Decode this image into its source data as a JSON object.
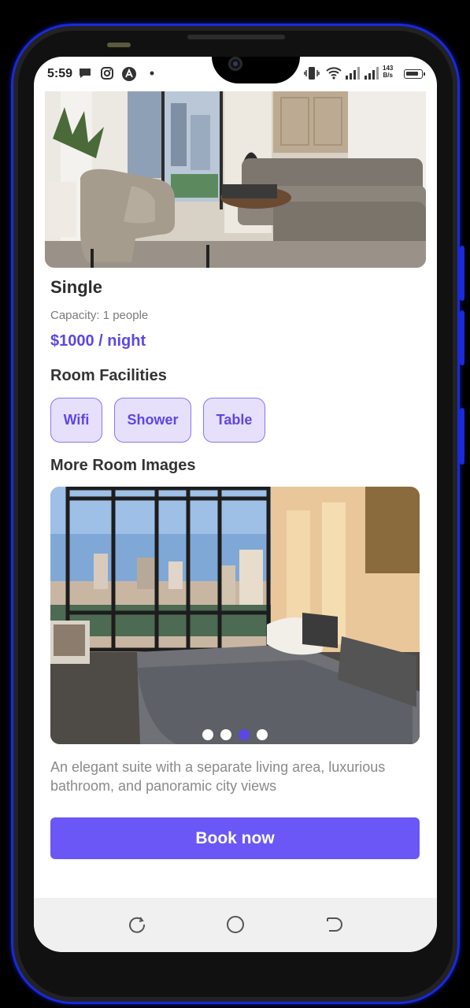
{
  "status_bar": {
    "time": "5:59",
    "net_speed_value": "143",
    "net_speed_unit": "B/s"
  },
  "room": {
    "name": "Single",
    "capacity": "Capacity: 1 people",
    "price": "$1000 / night"
  },
  "facilities": {
    "heading": "Room Facilities",
    "items": [
      "Wifi",
      "Shower",
      "Table"
    ]
  },
  "gallery": {
    "heading": "More Room Images",
    "page_count": 4,
    "active_index": 2
  },
  "description": "An elegant suite with a separate living area, luxurious bathroom, and panoramic city views",
  "actions": {
    "book_label": "Book now"
  },
  "colors": {
    "accent": "#6b57f5",
    "price": "#5b47e6",
    "chip_bg": "#e6e0fb",
    "frame": "#1a2ad8"
  },
  "icons": {
    "status": [
      "chat-bubble-icon",
      "instagram-icon",
      "app-a-icon",
      "vibrate-icon",
      "wifi-icon",
      "signal-icon",
      "battery-icon"
    ],
    "nav": [
      "recents-icon",
      "home-icon",
      "back-icon"
    ]
  }
}
